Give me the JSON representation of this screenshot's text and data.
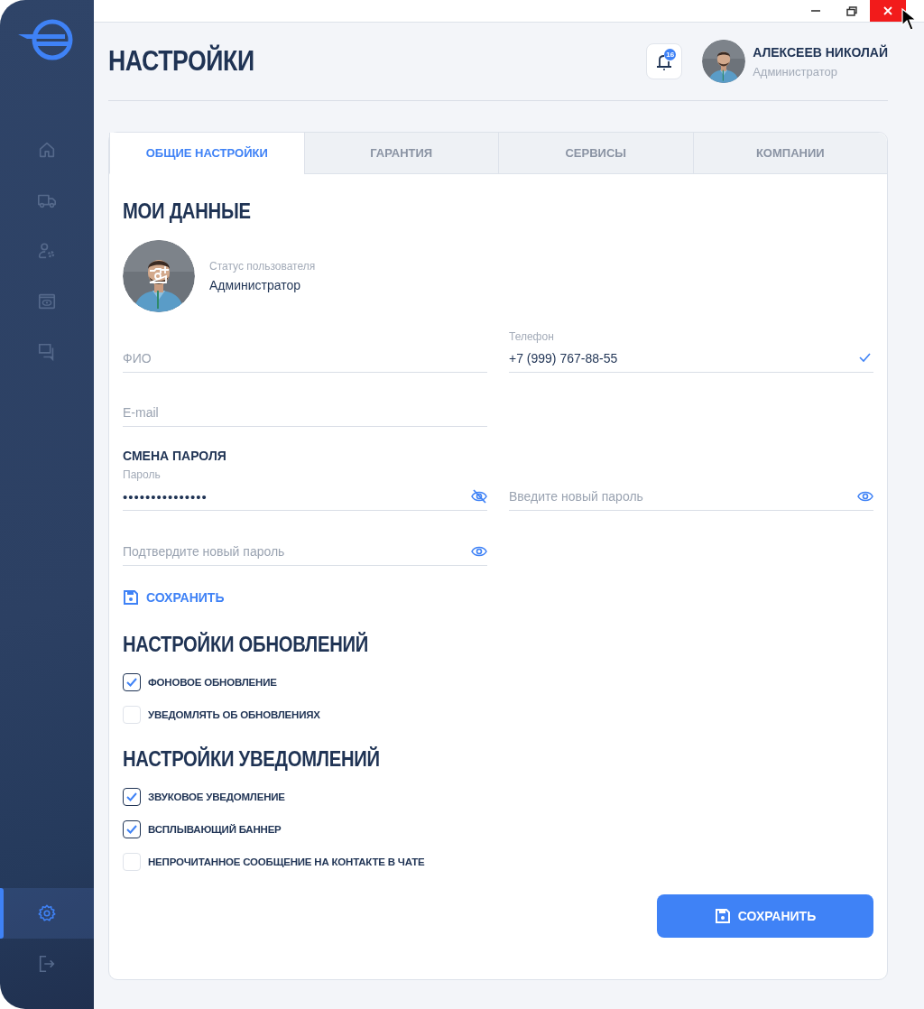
{
  "window": {
    "controls": [
      {
        "kind": "minimize"
      },
      {
        "kind": "restore"
      },
      {
        "kind": "close"
      }
    ],
    "cursor": true
  },
  "sidebar": {
    "items": [
      {
        "kind": "home",
        "selected": false
      },
      {
        "kind": "truck",
        "selected": false
      },
      {
        "kind": "user-settings",
        "selected": false
      },
      {
        "kind": "eye-window",
        "selected": false
      },
      {
        "kind": "chat",
        "selected": false
      }
    ],
    "bottom_items": [
      {
        "kind": "settings",
        "selected": true
      },
      {
        "kind": "logout",
        "selected": false
      }
    ]
  },
  "header": {
    "title": "НАСТРОЙКИ",
    "notifications": {
      "count": "16"
    },
    "user": {
      "name": "АЛЕКСЕЕВ НИКОЛАЙ",
      "role": "Администратор"
    }
  },
  "tabs": [
    {
      "label": "ОБЩИЕ НАСТРОЙКИ",
      "selected": true
    },
    {
      "label": "ГАРАНТИЯ",
      "selected": false
    },
    {
      "label": "СЕРВИСЫ",
      "selected": false
    },
    {
      "label": "КОМПАНИИ",
      "selected": false
    }
  ],
  "my_data": {
    "heading": "МОИ ДАННЫЕ",
    "status_label": "Статус пользователя",
    "status_value": "Администратор",
    "fields": [
      {
        "kind": "text",
        "placeholder": "ФИО"
      },
      {
        "kind": "phone",
        "label": "Телефон",
        "value": "+7 (999) 767-88-55"
      },
      {
        "kind": "text",
        "placeholder": "E-mail"
      }
    ]
  },
  "password": {
    "heading": "СМЕНА ПАРОЛЯ",
    "fields": [
      {
        "kind": "password",
        "label": "Пароль",
        "value": "•••••••••••••••",
        "masked": true
      },
      {
        "kind": "password",
        "placeholder": "Введите новый пароль",
        "masked": false
      },
      {
        "kind": "password",
        "placeholder": "Подтвердите новый пароль",
        "masked": false
      }
    ],
    "save_link": "СОХРАНИТЬ"
  },
  "updates": {
    "heading": "НАСТРОЙКИ ОБНОВЛЕНИЙ",
    "options": [
      {
        "label": "ФОНОВОЕ ОБНОВЛЕНИЕ",
        "checked": true
      },
      {
        "label": "УВЕДОМЛЯТЬ ОБ ОБНОВЛЕНИЯХ",
        "checked": false
      }
    ]
  },
  "notifications": {
    "heading": "НАСТРОЙКИ УВЕДОМЛЕНИЙ",
    "options": [
      {
        "label": "ЗВУКОВОЕ УВЕДОМЛЕНИЕ",
        "checked": true
      },
      {
        "label": "ВСПЛЫВАЮЩИЙ БАННЕР",
        "checked": true
      },
      {
        "label": "НЕПРОЧИТАННОЕ СООБЩЕНИЕ НА КОНТАКТЕ В ЧАТЕ",
        "checked": false
      }
    ]
  },
  "save_button": "СОХРАНИТЬ"
}
